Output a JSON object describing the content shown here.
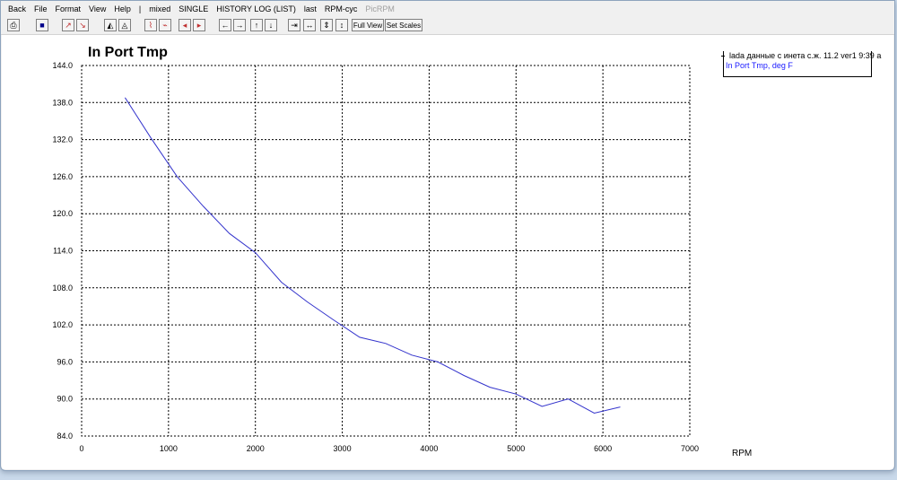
{
  "menu": [
    {
      "label": "Back",
      "enabled": true
    },
    {
      "label": "File",
      "enabled": true
    },
    {
      "label": "Format",
      "enabled": true
    },
    {
      "label": "View",
      "enabled": true
    },
    {
      "label": "Help",
      "enabled": true
    },
    {
      "label": "|",
      "enabled": true
    },
    {
      "label": "mixed",
      "enabled": true
    },
    {
      "label": "SINGLE",
      "enabled": true
    },
    {
      "label": "HISTORY LOG (LIST)",
      "enabled": true
    },
    {
      "label": "last",
      "enabled": true
    },
    {
      "label": "RPM-cyc",
      "enabled": true
    },
    {
      "label": "PicRPM",
      "enabled": false
    }
  ],
  "toolbar": {
    "full_view_label": "Full View",
    "set_scales_label": "Set Scales",
    "icons": [
      "printer-icon",
      "save-icon",
      "chart-up-icon",
      "chart-down-icon",
      "area-chart-icon",
      "area-chart-2-icon",
      "line-chart-red-icon",
      "line-chart-icon",
      "arrow-left-red-icon",
      "arrow-right-red-icon",
      "arrow-left-icon",
      "arrow-right-icon",
      "arrow-up-icon",
      "arrow-down-icon",
      "compress-horizontal-icon",
      "expand-horizontal-icon",
      "compress-vertical-icon",
      "expand-vertical-icon"
    ]
  },
  "legend": {
    "title": "lada данные с инета с.ж. 11.2 ver1 9:39 a",
    "series_label": "In Port Tmp, deg F"
  },
  "colors": {
    "series": "#3333cc",
    "grid": "#000000",
    "legend_series": "#1a1aff"
  },
  "chart_data": {
    "type": "line",
    "title": "In Port Tmp",
    "xlabel": "RPM",
    "ylabel": "",
    "xlim": [
      0,
      7000
    ],
    "ylim": [
      84.0,
      144.0
    ],
    "xticks": [
      0,
      1000,
      2000,
      3000,
      4000,
      5000,
      6000,
      7000
    ],
    "yticks": [
      "84.0",
      "90.0",
      "96.0",
      "102.0",
      "108.0",
      "114.0",
      "120.0",
      "126.0",
      "132.0",
      "138.0",
      "144.0"
    ],
    "grid": true,
    "legend_position": "top-right",
    "series": [
      {
        "name": "In Port Tmp, deg F",
        "x": [
          500,
          800,
          1100,
          1400,
          1700,
          2000,
          2300,
          2600,
          2900,
          3200,
          3500,
          3800,
          4100,
          4400,
          4700,
          5000,
          5300,
          5600,
          5900,
          6200
        ],
        "y": [
          138.8,
          132.2,
          126.0,
          121.2,
          116.8,
          113.7,
          108.9,
          105.7,
          102.8,
          100.0,
          99.0,
          97.1,
          96.0,
          93.8,
          91.9,
          90.8,
          88.8,
          90.0,
          87.7,
          88.7
        ]
      }
    ]
  }
}
